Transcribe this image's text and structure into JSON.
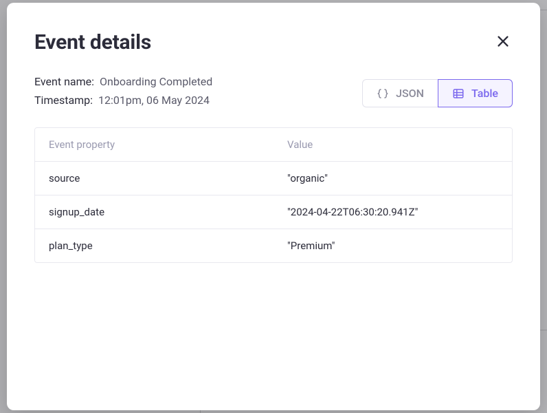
{
  "modal": {
    "title": "Event details",
    "event_name_label": "Event name:",
    "event_name_value": "Onboarding Completed",
    "timestamp_label": "Timestamp:",
    "timestamp_value": "12:01pm, 06 May 2024",
    "toggle": {
      "json_label": "JSON",
      "table_label": "Table"
    },
    "table": {
      "header_property": "Event property",
      "header_value": "Value",
      "rows": [
        {
          "property": "source",
          "value": "\"organic\""
        },
        {
          "property": "signup_date",
          "value": "\"2024-04-22T06:30:20.941Z\""
        },
        {
          "property": "plan_type",
          "value": "\"Premium\""
        }
      ]
    }
  }
}
